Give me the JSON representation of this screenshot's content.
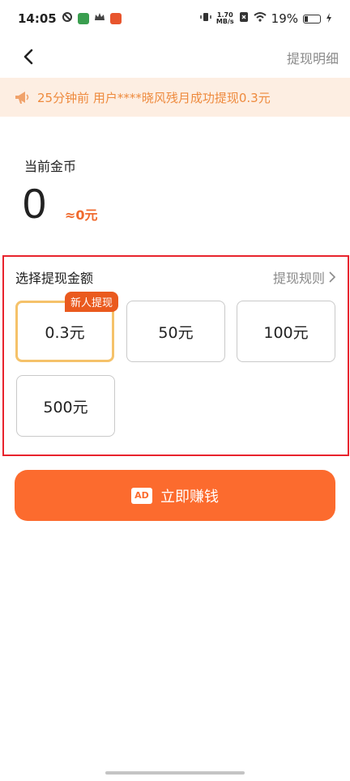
{
  "status_bar": {
    "time": "14:05",
    "speed_top": "1.70",
    "speed_bottom": "MB/s",
    "battery_percent": "19%",
    "battery_level": 0.19,
    "left_icons": [
      "sync-icon",
      "app-icon-green",
      "crown-icon",
      "app-icon-red"
    ],
    "right_icons": [
      "vibrate-icon",
      "sim-icon",
      "wifi-icon",
      "battery-icon",
      "charging-icon"
    ]
  },
  "nav": {
    "detail_link": "提现明细"
  },
  "notice": {
    "text": "25分钟前 用户****晓风残月成功提现0.3元"
  },
  "coins": {
    "label": "当前金币",
    "value": "0",
    "approx": "≈0元"
  },
  "amount_section": {
    "title": "选择提现金额",
    "rules_link": "提现规则",
    "options": [
      {
        "label": "0.3元",
        "selected": true,
        "badge": "新人提现"
      },
      {
        "label": "50元",
        "selected": false
      },
      {
        "label": "100元",
        "selected": false
      },
      {
        "label": "500元",
        "selected": false
      }
    ]
  },
  "earn_button": {
    "icon_text": "AD",
    "label": "立即赚钱"
  },
  "colors": {
    "accent": "#fc6b2e",
    "notice_bg": "#fdeee2",
    "notice_text": "#ee8a3d",
    "selected_border": "#f5c26a",
    "highlight_border": "#e8232d"
  }
}
